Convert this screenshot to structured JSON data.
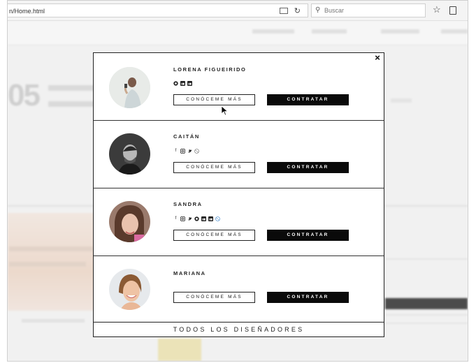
{
  "browser": {
    "url": "n/Home.html",
    "search_placeholder": "Buscar",
    "icons": [
      "reader-view-icon",
      "reload-icon",
      "search-icon",
      "bookmark-star-icon",
      "clipboard-icon"
    ]
  },
  "modal": {
    "close_label": "×",
    "more_label": "CONÓCEME MÁS",
    "hire_label": "CONTRATAR",
    "footer_label": "TODOS LOS DISEÑADORES",
    "designers": [
      {
        "name": "LORENA FIGUEIRIDO",
        "socials": [
          "pinterest",
          "linkedin",
          "linkedin"
        ]
      },
      {
        "name": "CAITÁN",
        "socials": [
          "facebook",
          "instagram",
          "twitter",
          "dribbble"
        ]
      },
      {
        "name": "SANDRA",
        "socials": [
          "facebook",
          "instagram",
          "twitter",
          "pinterest",
          "linkedin",
          "linkedin",
          "dribbble"
        ]
      },
      {
        "name": "MARIANA",
        "socials": []
      }
    ]
  },
  "colors": {
    "button_dark": "#0a0a0a",
    "border": "#222222",
    "background": "#ffffff"
  }
}
